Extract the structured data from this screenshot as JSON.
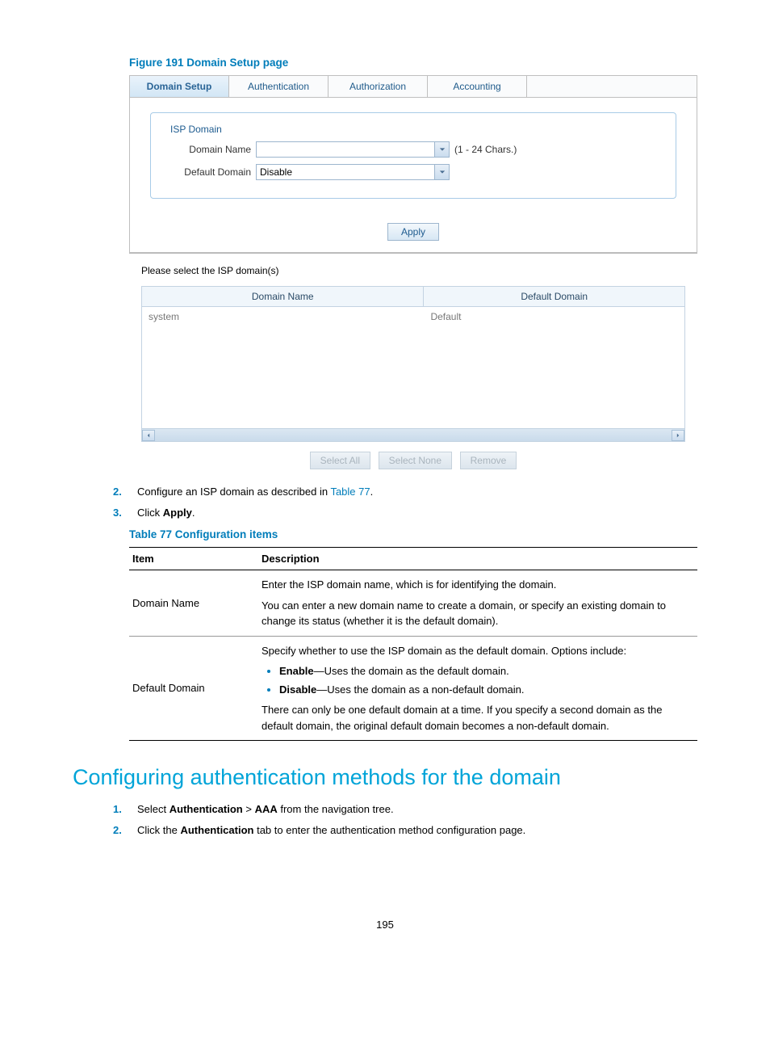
{
  "figure_caption": "Figure 191 Domain Setup page",
  "tabs": {
    "domain_setup": "Domain Setup",
    "authentication": "Authentication",
    "authorization": "Authorization",
    "accounting": "Accounting"
  },
  "fieldset": {
    "legend": "ISP Domain",
    "domain_name_label": "Domain Name",
    "domain_name_value": "",
    "domain_name_hint": "(1 - 24 Chars.)",
    "default_domain_label": "Default Domain",
    "default_domain_value": "Disable"
  },
  "apply_button": "Apply",
  "grid_instruction": "Please select the ISP domain(s)",
  "grid": {
    "col1_header": "Domain Name",
    "col2_header": "Default Domain",
    "row1_col1": "system",
    "row1_col2": "Default"
  },
  "grid_buttons": {
    "select_all": "Select All",
    "select_none": "Select None",
    "remove": "Remove"
  },
  "step2_pre": "Configure an ISP domain as described in ",
  "step2_link": "Table 77",
  "step2_post": ".",
  "step3_pre": "Click ",
  "step3_bold": "Apply",
  "step3_post": ".",
  "step2_num": "2.",
  "step3_num": "3.",
  "table_caption": "Table 77 Configuration items",
  "table": {
    "th_item": "Item",
    "th_desc": "Description",
    "r1_item": "Domain Name",
    "r1_p1": "Enter the ISP domain name, which is for identifying the domain.",
    "r1_p2": "You can enter a new domain name to create a domain, or specify an existing domain to change its status (whether it is the default domain).",
    "r2_item": "Default Domain",
    "r2_p1": "Specify whether to use the ISP domain as the default domain. Options include:",
    "r2_b1_strong": "Enable",
    "r2_b1_rest": "—Uses the domain as the default domain.",
    "r2_b2_strong": "Disable",
    "r2_b2_rest": "—Uses the domain as a non-default domain.",
    "r2_p3": "There can only be one default domain at a time. If you specify a second domain as the default domain, the original default domain becomes a non-default domain."
  },
  "section_heading": "Configuring authentication methods for the domain",
  "auth_step1_num": "1.",
  "auth_step1_a": "Select ",
  "auth_step1_b": "Authentication",
  "auth_step1_c": " > ",
  "auth_step1_d": "AAA",
  "auth_step1_e": " from the navigation tree.",
  "auth_step2_num": "2.",
  "auth_step2_a": "Click the ",
  "auth_step2_b": "Authentication",
  "auth_step2_c": " tab to enter the authentication method configuration page.",
  "page_number": "195"
}
